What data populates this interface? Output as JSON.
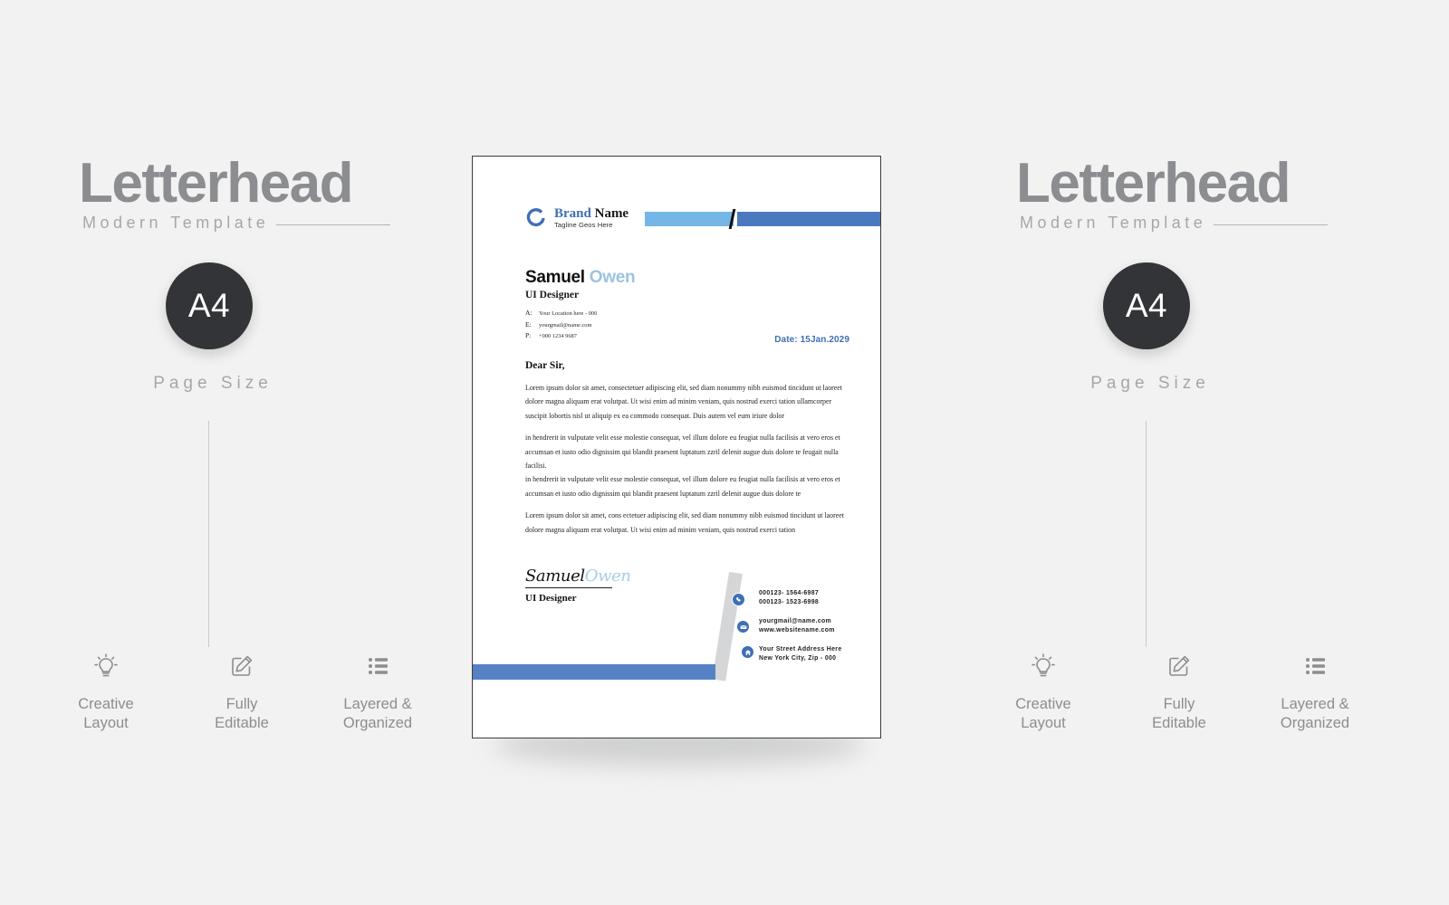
{
  "promo": {
    "title": "Letterhead",
    "subtitle": "Modern Template",
    "badge_value": "A4",
    "badge_caption": "Page Size",
    "features": [
      {
        "icon": "lightbulb-icon",
        "label": "Creative\nLayout"
      },
      {
        "icon": "edit-pencil-icon",
        "label": "Fully\nEditable"
      },
      {
        "icon": "list-layers-icon",
        "label": "Layered &\nOrganized"
      }
    ]
  },
  "letterhead": {
    "logo_icon": "circle-c-logo-icon",
    "brand_name_primary": "Brand",
    "brand_name_secondary": "Name",
    "brand_tagline": "Tagline Geos Here",
    "recipient": {
      "first_name": "Samuel",
      "last_name": "Owen",
      "role": "UI Designer",
      "contact": [
        {
          "key": "A:",
          "value": "Your Location here - 000"
        },
        {
          "key": "E:",
          "value": "yourgmail@name.com"
        },
        {
          "key": "P:",
          "value": "+000 1234 9687"
        }
      ]
    },
    "date": "Date: 15Jan.2029",
    "salutation": "Dear Sir,",
    "paragraphs": [
      "Lorem ipsum dolor sit amet, consectetuer adipiscing elit, sed diam nonummy nibh euismod tincidunt ut laoreet dolore magna aliquam erat volutpat. Ut wisi enim ad minim veniam, quis nostrud exerci tation ullamcorper suscipit lobortis nisl ut aliquip ex ea commodo consequat. Duis autem vel eum iriure dolor",
      " in hendrerit in vulputate velit esse molestie consequat, vel illum dolore eu feugiat nulla facilisis at vero eros et accumsan et iusto odio dignissim qui blandit praesent luptatum zzril delenit augue duis dolore te feugait nulla facilisi.",
      "in hendrerit in vulputate velit esse molestie consequat, vel illum dolore eu feugiat nulla facilisis at vero eros et accumsan et iusto odio dignissim qui blandit praesent luptatum zzril delenit augue duis dolore te",
      "Lorem ipsum dolor sit amet, cons ectetuer adipiscing elit, sed diam nonummy nibh euismod tincidunt ut laoreet dolore magna aliquam erat volutpat. Ut wisi enim ad minim veniam, quis nostrud exerci tation"
    ],
    "signature": {
      "first_name": "Samuel",
      "last_name": "Owen",
      "role": "UI Designer"
    },
    "footer": {
      "phone_icon": "phone-icon",
      "mail_icon": "mail-icon",
      "home_icon": "home-icon",
      "phone_1": "000123- 1564-6987",
      "phone_2": "000123- 1523-6998",
      "email": "yourgmail@name.com",
      "website": "www.websitename.com",
      "address_1": "Your Street Address Here",
      "address_2": "New York City, Zip - 000"
    }
  },
  "colors": {
    "accent_blue": "#4a79c0",
    "light_blue": "#74b7e6",
    "badge_dark": "#333438",
    "muted_gray": "#8c8d90"
  }
}
